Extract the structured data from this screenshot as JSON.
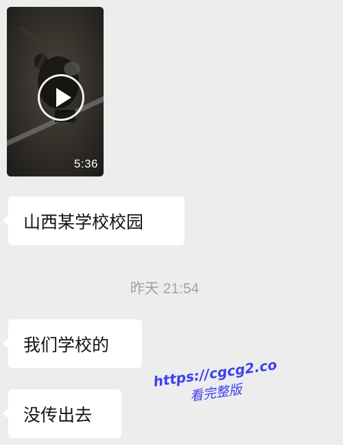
{
  "video_message": {
    "duration": "5:36",
    "play_icon": "play-icon"
  },
  "messages": [
    {
      "text": "山西某学校校园"
    },
    {
      "text": "我们学校的"
    },
    {
      "text": "没传出去"
    }
  ],
  "timestamp": "昨天 21:54",
  "watermark": {
    "url": "https://cgcg2.co",
    "caption": "看完整版",
    "color": "#3f3ff0"
  },
  "colors": {
    "background": "#ededed",
    "bubble": "#ffffff",
    "timestamp": "#a3a3a3"
  }
}
